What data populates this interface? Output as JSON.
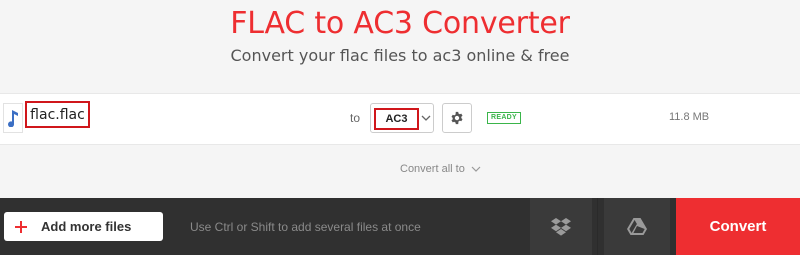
{
  "header": {
    "title": "FLAC to AC3 Converter",
    "subtitle": "Convert your flac files to ac3 online & free"
  },
  "file": {
    "icon": "music-note-icon",
    "name": "flac.flac",
    "to_label": "to",
    "format": "AC3",
    "status": "READY",
    "size": "11.8 MB"
  },
  "convert_all": {
    "label": "Convert all to"
  },
  "bottom": {
    "add_label": "Add more files",
    "hint": "Use Ctrl or Shift to add several files at once",
    "convert_label": "Convert"
  },
  "colors": {
    "accent": "#ee2e31",
    "highlight": "#d0161b",
    "ready": "#3ab54a",
    "bar": "#303030"
  }
}
